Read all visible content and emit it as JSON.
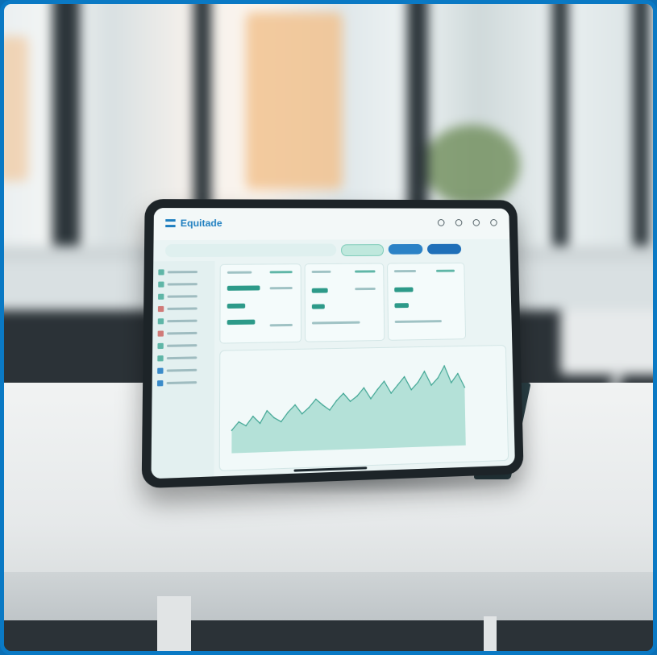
{
  "app": {
    "brand": "Equitade"
  },
  "colors": {
    "frame_border": "#0a79c4",
    "accent_blue": "#1f7fc0",
    "accent_teal": "#2d9a89",
    "screen_bg": "#eaf4f4"
  },
  "icons": {
    "logo": "logo-icon",
    "toolbar_icons": [
      "notification-icon",
      "settings-icon",
      "profile-icon",
      "menu-icon"
    ]
  },
  "chart_data": {
    "type": "area",
    "values": [
      22,
      30,
      26,
      35,
      28,
      40,
      33,
      29,
      38,
      45,
      36,
      42,
      50,
      44,
      39,
      48,
      55,
      47,
      52,
      60,
      49,
      58,
      66,
      54,
      62,
      70,
      57,
      64,
      75,
      61,
      68,
      80,
      63,
      72,
      58
    ]
  }
}
